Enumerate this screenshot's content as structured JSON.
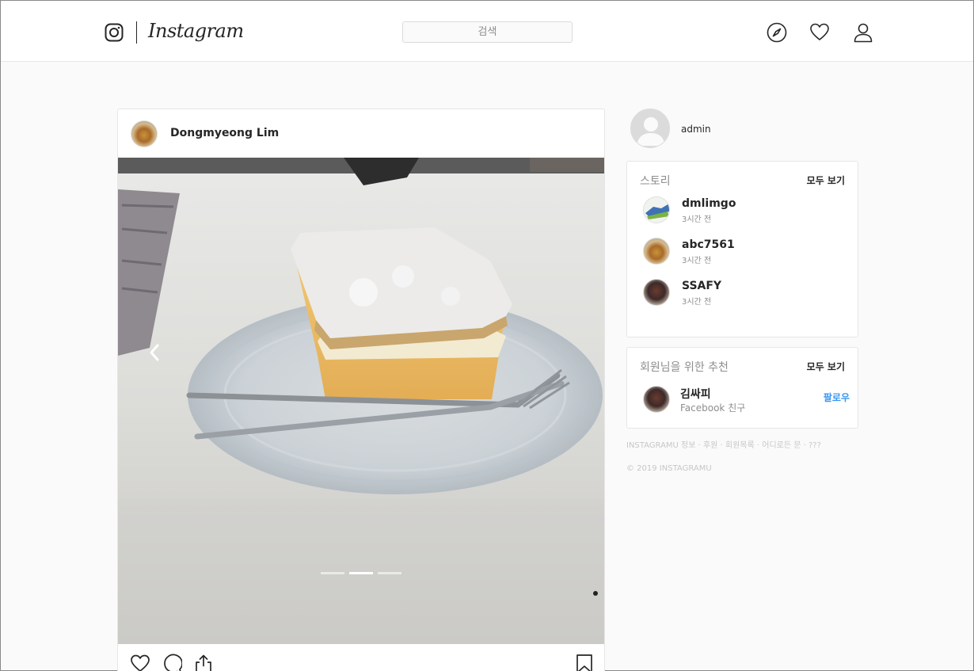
{
  "header": {
    "brand": "Instagram",
    "search_placeholder": "검색",
    "icons": [
      "instagram-camera-icon",
      "compass-icon",
      "heart-icon",
      "user-icon"
    ]
  },
  "post": {
    "username": "Dongmyeong Lim",
    "image_alt": "Cream cake slice on a glass plate with a fork",
    "carousel": {
      "total": 3,
      "current": 2
    },
    "actions": [
      "heart-icon",
      "comment-icon",
      "share-icon",
      "bookmark-icon"
    ]
  },
  "profile": {
    "username": "admin"
  },
  "stories": {
    "title": "스토리",
    "see_all": "모두 보기",
    "items": [
      {
        "name": "dmlimgo",
        "time": "3시간 전"
      },
      {
        "name": "abc7561",
        "time": "3시간 전"
      },
      {
        "name": "SSAFY",
        "time": "3시간 전"
      }
    ]
  },
  "recommendations": {
    "title": "회원님을 위한 추천",
    "see_all": "모두 보기",
    "items": [
      {
        "name": "김싸피",
        "subtitle": "Facebook 친구",
        "action": "팔로우"
      }
    ]
  },
  "footer": {
    "links": "INSTAGRAMU 정보 · 후원 · 회원목록 · 어디로든 문 · ???",
    "copyright": "© 2019 INSTAGRAMU"
  },
  "colors": {
    "link_blue": "#3897f0",
    "muted": "#8e8e8e",
    "border": "#e6e6e6"
  }
}
